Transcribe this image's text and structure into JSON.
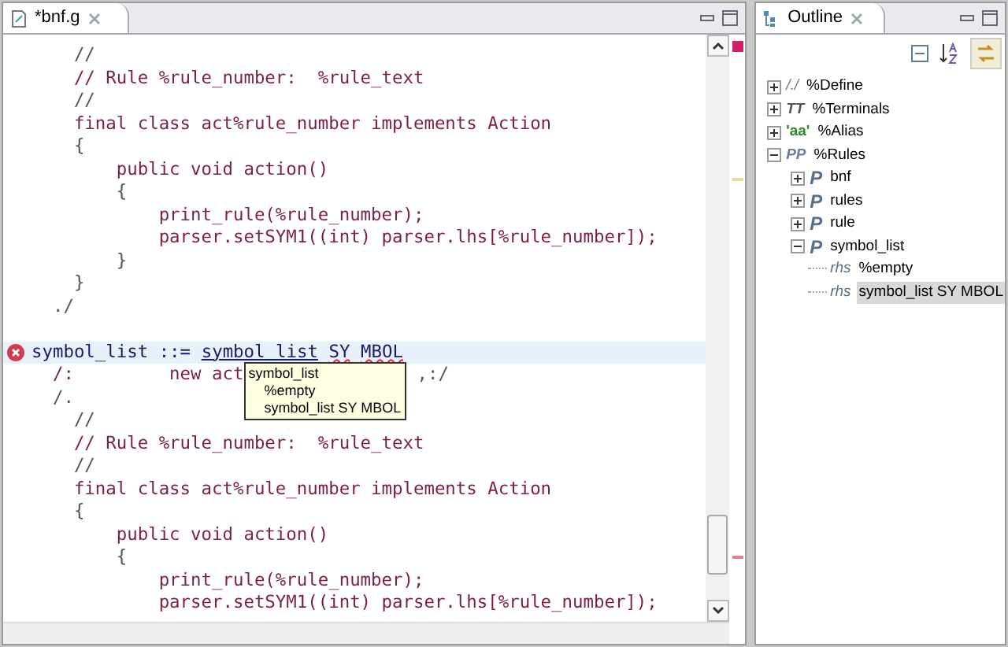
{
  "editor": {
    "tab": {
      "title": "*bnf.g"
    },
    "lines": [
      {
        "kind": "comment",
        "text": "    //"
      },
      {
        "kind": "code",
        "text": "    // Rule %rule_number:  %rule_text"
      },
      {
        "kind": "comment",
        "text": "    //"
      },
      {
        "kind": "code",
        "text": "    final class act%rule_number implements Action"
      },
      {
        "kind": "comment",
        "text": "    {"
      },
      {
        "kind": "code",
        "text": "        public void action()"
      },
      {
        "kind": "comment",
        "text": "        {"
      },
      {
        "kind": "code",
        "text": "            print_rule(%rule_number);"
      },
      {
        "kind": "code",
        "text": "            parser.setSYM1((int) parser.lhs[%rule_number]);"
      },
      {
        "kind": "comment",
        "text": "        }"
      },
      {
        "kind": "comment",
        "text": "    }"
      },
      {
        "kind": "comment",
        "text": "  ./"
      },
      {
        "kind": "blank"
      },
      {
        "kind": "grammar",
        "error": true,
        "lhs": "symbol_list ::=",
        "link": "symbol list",
        "errors": [
          "SY",
          "MBOL"
        ]
      },
      {
        "kind": "split",
        "parts": [
          "  /:         new act",
          ",:/"
        ]
      },
      {
        "kind": "comment",
        "text": "  /."
      },
      {
        "kind": "comment",
        "text": "    //"
      },
      {
        "kind": "code",
        "text": "    // Rule %rule_number:  %rule_text"
      },
      {
        "kind": "comment",
        "text": "    //"
      },
      {
        "kind": "code",
        "text": "    final class act%rule_number implements Action"
      },
      {
        "kind": "comment",
        "text": "    {"
      },
      {
        "kind": "code",
        "text": "        public void action()"
      },
      {
        "kind": "comment",
        "text": "        {"
      },
      {
        "kind": "code",
        "text": "            print_rule(%rule_number);"
      },
      {
        "kind": "code",
        "text": "            parser.setSYM1((int) parser.lhs[%rule_number]);"
      }
    ],
    "tooltip": {
      "title": "symbol_list",
      "items": [
        "%empty",
        "symbol_list SY MBOL"
      ]
    }
  },
  "outline": {
    "tab": {
      "title": "Outline"
    },
    "tree": [
      {
        "badge": "/./",
        "kind": "define",
        "label": "%Define",
        "expanded": false,
        "selected": false
      },
      {
        "badge": "TT",
        "kind": "terminal",
        "label": "%Terminals",
        "expanded": false,
        "selected": false
      },
      {
        "badge": "'aa'",
        "kind": "alias",
        "label": "%Alias",
        "expanded": false,
        "selected": false
      },
      {
        "badge": "PP",
        "kind": "rules",
        "label": "%Rules",
        "expanded": true,
        "selected": false,
        "children": [
          {
            "badge": "P",
            "kind": "rule",
            "label": "bnf",
            "expanded": false,
            "selected": false
          },
          {
            "badge": "P",
            "kind": "rule",
            "label": "rules",
            "expanded": false,
            "selected": false
          },
          {
            "badge": "P",
            "kind": "rule",
            "label": "rule",
            "expanded": false,
            "selected": false
          },
          {
            "badge": "P",
            "kind": "rule",
            "label": "symbol_list",
            "expanded": true,
            "selected": false,
            "children": [
              {
                "badge": "rhs",
                "kind": "rhs",
                "label": "%empty",
                "selected": false
              },
              {
                "badge": "rhs",
                "kind": "rhs",
                "label": "symbol_list SY MBOL",
                "selected": true
              }
            ]
          }
        ]
      }
    ]
  }
}
